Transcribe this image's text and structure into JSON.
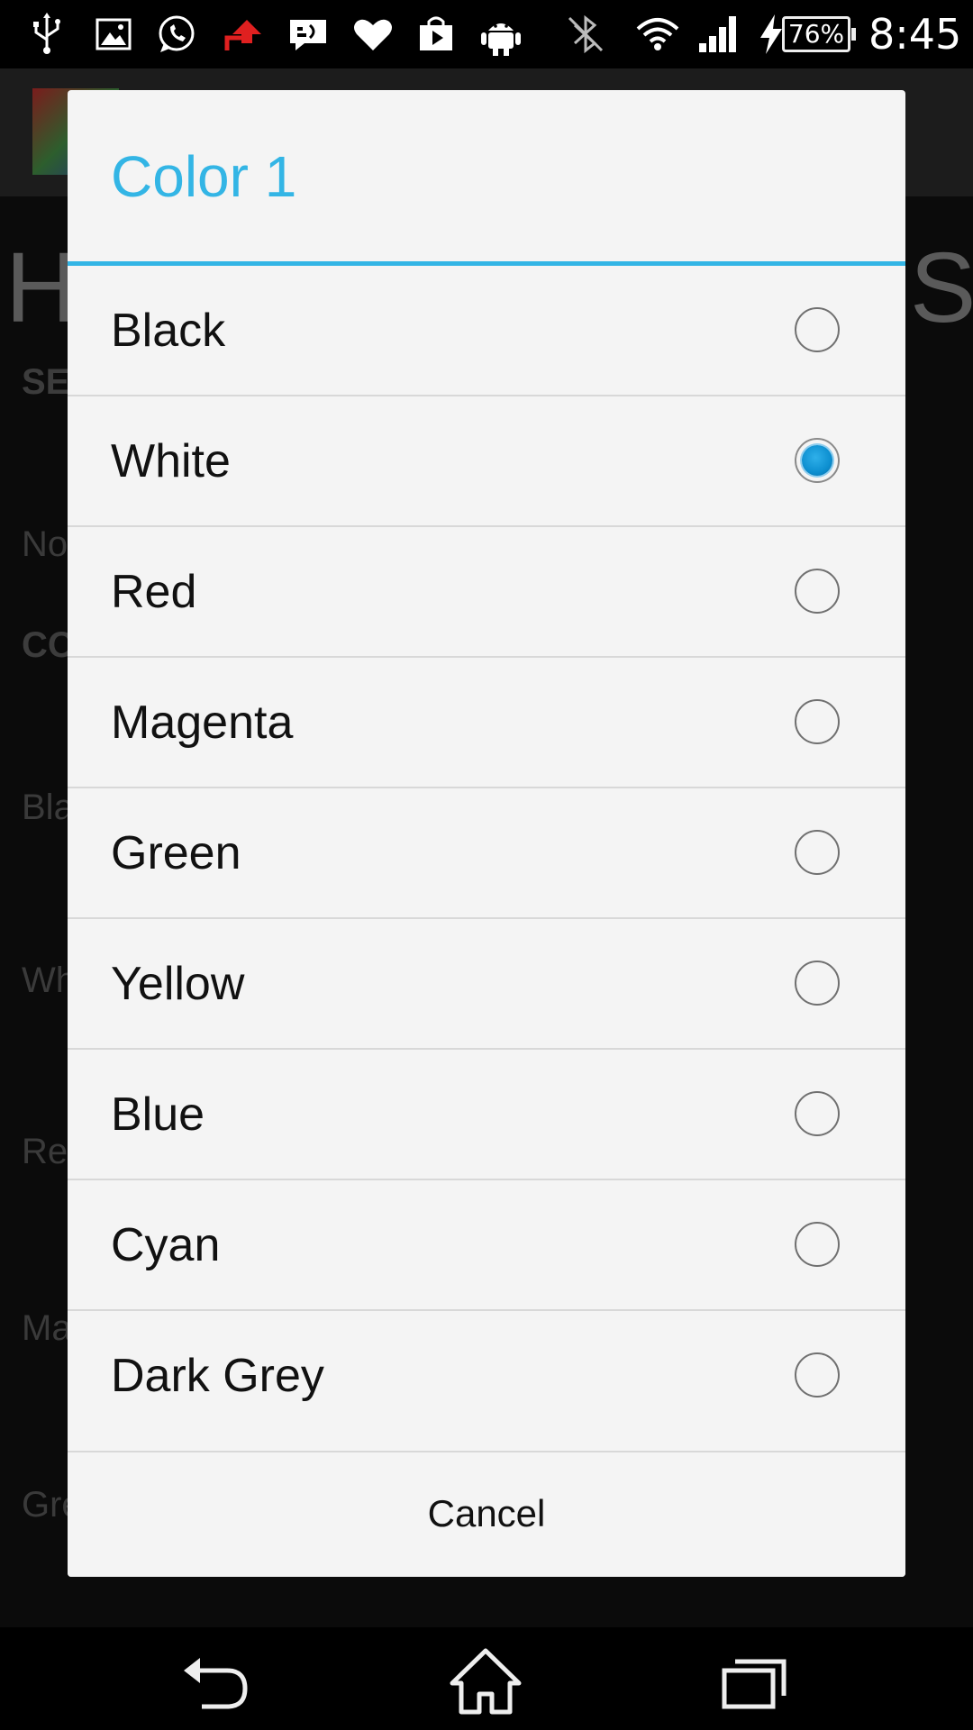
{
  "status_bar": {
    "battery_level": "76%",
    "time": "8:45",
    "icons": [
      "usb-icon",
      "gallery-icon",
      "whatsapp-icon",
      "upload-icon",
      "message-icon",
      "heart-icon",
      "play-store-icon",
      "android-icon",
      "bluetooth-off-icon",
      "wifi-icon",
      "signal-icon",
      "charging-icon",
      "battery-icon"
    ]
  },
  "background_app": {
    "title_left": "H",
    "title_right": "S",
    "rows": [
      {
        "text": "SE",
        "bold": true
      },
      {
        "text": "No",
        "bold": false
      },
      {
        "text": "CO",
        "bold": true
      },
      {
        "text": "Bla",
        "bold": false
      },
      {
        "text": "Wh",
        "bold": false
      },
      {
        "text": "Re",
        "bold": false
      },
      {
        "text": "Ma",
        "bold": false
      },
      {
        "text": "Gre",
        "bold": false
      }
    ]
  },
  "dialog": {
    "title": "Color 1",
    "accent_color": "#33b5e5",
    "selected": "White",
    "options": [
      {
        "label": "Black",
        "checked": false
      },
      {
        "label": "White",
        "checked": true
      },
      {
        "label": "Red",
        "checked": false
      },
      {
        "label": "Magenta",
        "checked": false
      },
      {
        "label": "Green",
        "checked": false
      },
      {
        "label": "Yellow",
        "checked": false
      },
      {
        "label": "Blue",
        "checked": false
      },
      {
        "label": "Cyan",
        "checked": false
      },
      {
        "label": "Dark Grey",
        "checked": false
      }
    ],
    "cancel_label": "Cancel"
  },
  "nav_bar": {
    "buttons": [
      "back-icon",
      "home-icon",
      "recent-apps-icon"
    ]
  }
}
